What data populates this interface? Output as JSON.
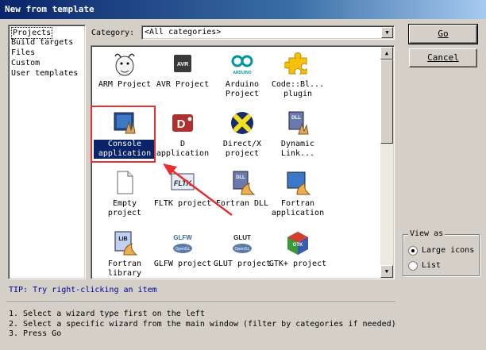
{
  "window": {
    "title": "New from template"
  },
  "categories": {
    "items": [
      "Projects",
      "Build targets",
      "Files",
      "Custom",
      "User templates"
    ],
    "selected": "Projects"
  },
  "category_filter": {
    "label": "Category:",
    "value": "<All categories>"
  },
  "wizards": [
    {
      "name": "wiz-arm-project",
      "label": "ARM Project",
      "icon": "gnu-gnu-icon"
    },
    {
      "name": "wiz-avr-project",
      "label": "AVR Project",
      "icon": "avr-chip-icon"
    },
    {
      "name": "wiz-arduino-project",
      "label": "Arduino Project",
      "icon": "arduino-icon"
    },
    {
      "name": "wiz-codeblocks-plugin",
      "label": "Code::Bl... plugin",
      "icon": "puzzle-piece-icon"
    },
    {
      "name": "wiz-console-application",
      "label": "Console application",
      "icon": "console-app-icon",
      "selected": true
    },
    {
      "name": "wiz-d-application",
      "label": "D application",
      "icon": "d-language-icon"
    },
    {
      "name": "wiz-directx-project",
      "label": "Direct/X project",
      "icon": "directx-icon"
    },
    {
      "name": "wiz-dynamic-link-library",
      "label": "Dynamic Link...",
      "icon": "dll-icon"
    },
    {
      "name": "wiz-empty-project",
      "label": "Empty project",
      "icon": "blank-page-icon"
    },
    {
      "name": "wiz-fltk-project",
      "label": "FLTK project",
      "icon": "fltk-icon"
    },
    {
      "name": "wiz-fortran-dll",
      "label": "Fortran DLL",
      "icon": "fortran-dll-icon"
    },
    {
      "name": "wiz-fortran-application",
      "label": "Fortran application",
      "icon": "fortran-app-icon"
    },
    {
      "name": "wiz-fortran-library",
      "label": "Fortran library",
      "icon": "fortran-lib-icon"
    },
    {
      "name": "wiz-glfw-project",
      "label": "GLFW project",
      "icon": "glfw-icon"
    },
    {
      "name": "wiz-glut-project",
      "label": "GLUT project",
      "icon": "glut-icon"
    },
    {
      "name": "wiz-gtk-project",
      "label": "GTK+ project",
      "icon": "gtk-icon"
    }
  ],
  "buttons": {
    "go": "Go",
    "cancel": "Cancel"
  },
  "view_as": {
    "legend": "View as",
    "large_icons": "Large icons",
    "list": "List",
    "selected": "Large icons"
  },
  "tip": "TIP: Try right-clicking an item",
  "steps": [
    "1. Select a wizard type first on the left",
    "2. Select a specific wizard from the main window (filter by categories if needed)",
    "3. Press Go"
  ],
  "avr_icon_text": "AVR",
  "arduino_icon_text": "ARDUINO",
  "dll_icon_text": "DLL",
  "fltk_icon_text": "FLTK",
  "lib_icon_text": "LIB",
  "glfw_icon_text": "GLFW",
  "glut_icon_text": "GLUT",
  "gtk_icon_text": "GTK"
}
